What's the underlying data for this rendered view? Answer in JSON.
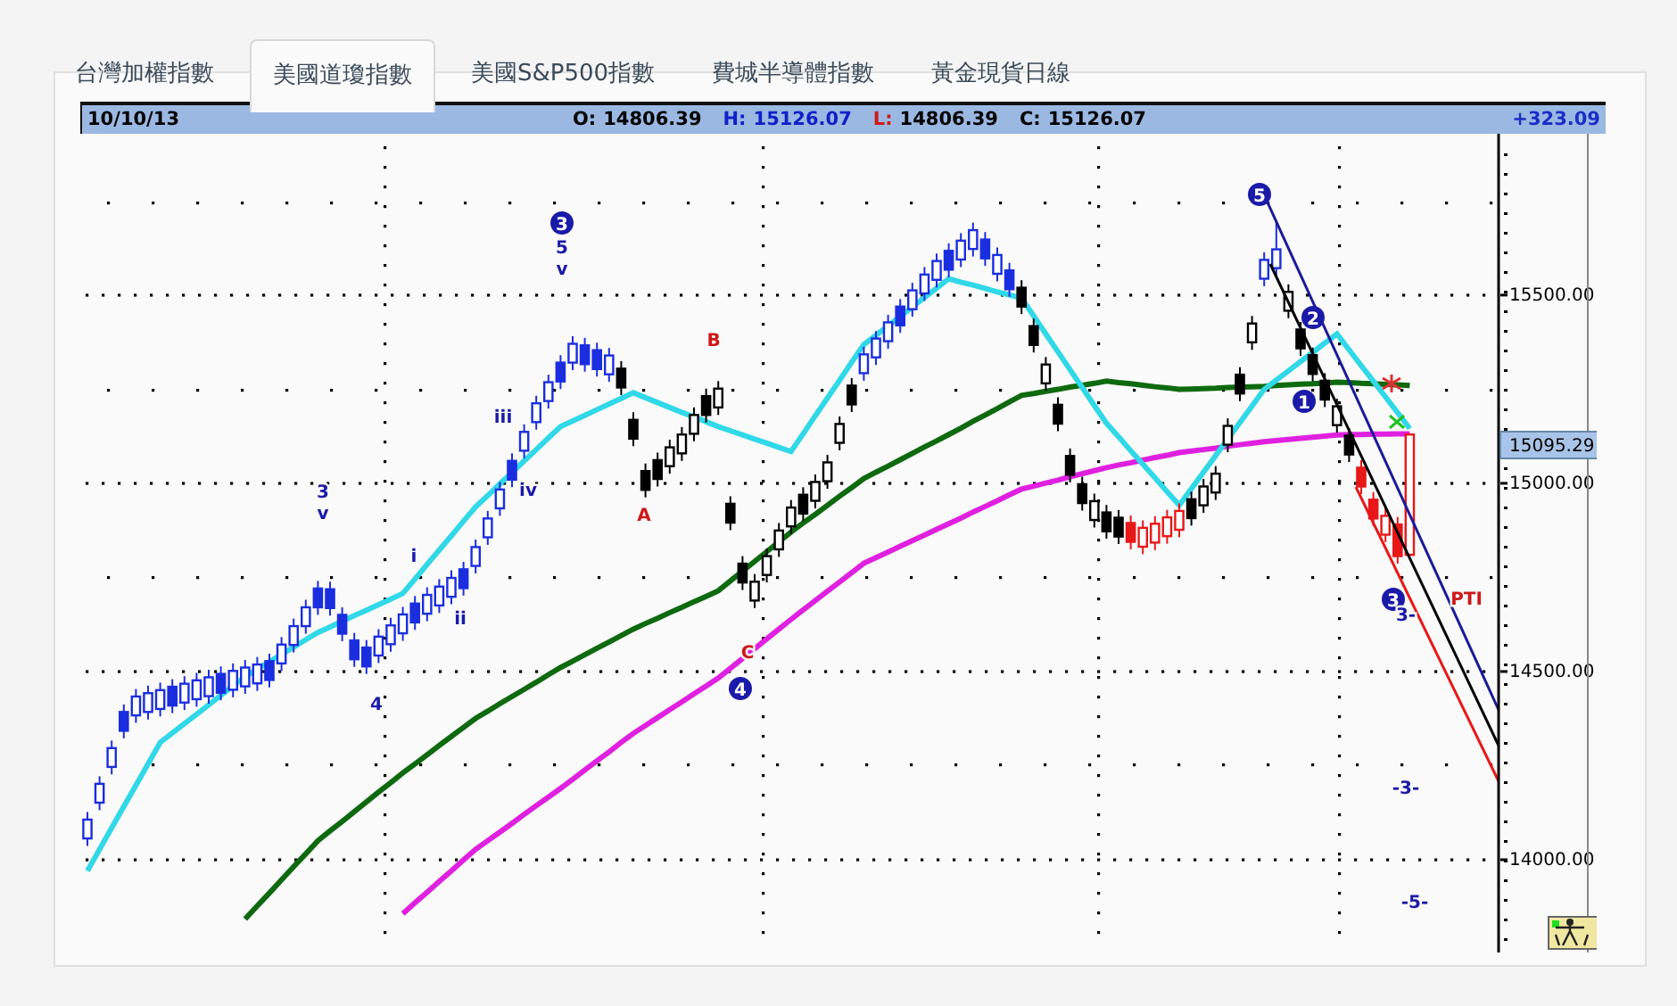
{
  "tabs": [
    {
      "label": "台灣加權指數",
      "selected": false
    },
    {
      "label": "美國道瓊指數",
      "selected": true
    },
    {
      "label": "美國S&P500指數",
      "selected": false
    },
    {
      "label": "費城半導體指數",
      "selected": false
    },
    {
      "label": "黃金現貨日線",
      "selected": false
    }
  ],
  "quote_bar": {
    "date": "10/10/13",
    "fields": [
      {
        "text": "O:",
        "color": "#000000"
      },
      {
        "text": "14806.39",
        "color": "#000000"
      },
      {
        "text": "H:",
        "color": "#1020c8"
      },
      {
        "text": "15126.07",
        "color": "#1020c8"
      },
      {
        "text": "L:",
        "color": "#d01818"
      },
      {
        "text": "14806.39",
        "color": "#000000"
      },
      {
        "text": "C:",
        "color": "#000000"
      },
      {
        "text": "15126.07",
        "color": "#000000"
      }
    ],
    "change": "+323.09"
  },
  "chart_data": {
    "type": "candlestick",
    "ylim": [
      13750,
      15925
    ],
    "yticks": [
      {
        "value": 15500,
        "label": "15500.00"
      },
      {
        "value": 15000,
        "label": "15000.00"
      },
      {
        "value": 14500,
        "label": "14500.00"
      },
      {
        "value": 14000,
        "label": "14000.00"
      }
    ],
    "ohlc": [
      [
        14053,
        14123,
        14033,
        14103
      ],
      [
        14148,
        14218,
        14128,
        14198
      ],
      [
        14243,
        14313,
        14223,
        14293
      ],
      [
        14389,
        14409,
        14319,
        14339
      ],
      [
        14380,
        14450,
        14360,
        14430
      ],
      [
        14389,
        14459,
        14369,
        14439
      ],
      [
        14397,
        14467,
        14377,
        14447
      ],
      [
        14456,
        14476,
        14386,
        14406
      ],
      [
        14414,
        14484,
        14394,
        14464
      ],
      [
        14423,
        14493,
        14403,
        14473
      ],
      [
        14431,
        14501,
        14411,
        14481
      ],
      [
        14490,
        14510,
        14420,
        14440
      ],
      [
        14448,
        14518,
        14428,
        14498
      ],
      [
        14457,
        14527,
        14437,
        14507
      ],
      [
        14465,
        14535,
        14445,
        14515
      ],
      [
        14524,
        14544,
        14454,
        14474
      ],
      [
        14518,
        14588,
        14498,
        14568
      ],
      [
        14567,
        14637,
        14547,
        14617
      ],
      [
        14617,
        14687,
        14597,
        14667
      ],
      [
        14717,
        14737,
        14647,
        14667
      ],
      [
        14715,
        14735,
        14645,
        14665
      ],
      [
        14647,
        14667,
        14577,
        14597
      ],
      [
        14579,
        14599,
        14509,
        14529
      ],
      [
        14560,
        14580,
        14490,
        14510
      ],
      [
        14539,
        14609,
        14519,
        14589
      ],
      [
        14569,
        14639,
        14549,
        14619
      ],
      [
        14598,
        14668,
        14578,
        14648
      ],
      [
        14677,
        14697,
        14607,
        14627
      ],
      [
        14650,
        14720,
        14630,
        14700
      ],
      [
        14672,
        14742,
        14652,
        14722
      ],
      [
        14695,
        14765,
        14675,
        14745
      ],
      [
        14768,
        14788,
        14698,
        14718
      ],
      [
        14777,
        14847,
        14757,
        14827
      ],
      [
        14853,
        14923,
        14833,
        14903
      ],
      [
        14930,
        15000,
        14910,
        14980
      ],
      [
        15056,
        15076,
        14986,
        15006
      ],
      [
        15083,
        15153,
        15063,
        15133
      ],
      [
        15159,
        15229,
        15139,
        15209
      ],
      [
        15215,
        15285,
        15195,
        15265
      ],
      [
        15317,
        15337,
        15247,
        15267
      ],
      [
        15317,
        15387,
        15297,
        15367
      ],
      [
        15363,
        15383,
        15293,
        15313
      ],
      [
        15350,
        15370,
        15280,
        15300
      ],
      [
        15286,
        15356,
        15266,
        15336
      ],
      [
        15301,
        15321,
        15231,
        15251
      ],
      [
        15165,
        15185,
        15095,
        15115
      ],
      [
        15029,
        15049,
        14959,
        14979
      ],
      [
        15058,
        15078,
        14988,
        15008
      ],
      [
        15042,
        15112,
        15022,
        15092
      ],
      [
        15076,
        15146,
        15056,
        15126
      ],
      [
        15128,
        15198,
        15108,
        15178
      ],
      [
        15228,
        15248,
        15158,
        15178
      ],
      [
        15198,
        15268,
        15178,
        15248
      ],
      [
        14942,
        14962,
        14872,
        14892
      ],
      [
        14783,
        14803,
        14713,
        14733
      ],
      [
        14685,
        14755,
        14665,
        14735
      ],
      [
        14753,
        14823,
        14733,
        14803
      ],
      [
        14821,
        14891,
        14801,
        14871
      ],
      [
        14882,
        14952,
        14862,
        14932
      ],
      [
        14966,
        14986,
        14896,
        14916
      ],
      [
        14950,
        15020,
        14930,
        15000
      ],
      [
        15002,
        15072,
        14982,
        15052
      ],
      [
        15104,
        15174,
        15084,
        15154
      ],
      [
        15256,
        15276,
        15186,
        15206
      ],
      [
        15289,
        15359,
        15269,
        15339
      ],
      [
        15331,
        15401,
        15311,
        15381
      ],
      [
        15374,
        15444,
        15354,
        15424
      ],
      [
        15466,
        15486,
        15396,
        15416
      ],
      [
        15459,
        15529,
        15439,
        15509
      ],
      [
        15501,
        15571,
        15481,
        15551
      ],
      [
        15537,
        15607,
        15517,
        15587
      ],
      [
        15614,
        15634,
        15544,
        15564
      ],
      [
        15591,
        15661,
        15571,
        15641
      ],
      [
        15619,
        15689,
        15599,
        15669
      ],
      [
        15644,
        15664,
        15574,
        15594
      ],
      [
        15553,
        15623,
        15533,
        15603
      ],
      [
        15562,
        15582,
        15492,
        15512
      ],
      [
        15516,
        15536,
        15446,
        15466
      ],
      [
        15414,
        15434,
        15344,
        15364
      ],
      [
        15262,
        15332,
        15242,
        15312
      ],
      [
        15205,
        15225,
        15135,
        15155
      ],
      [
        15069,
        15089,
        14999,
        15019
      ],
      [
        14994,
        15014,
        14924,
        14944
      ],
      [
        14899,
        14969,
        14879,
        14949
      ],
      [
        14919,
        14939,
        14849,
        14869
      ],
      [
        14905,
        14925,
        14835,
        14855
      ],
      [
        14891,
        14911,
        14821,
        14841
      ],
      [
        14828,
        14898,
        14808,
        14878
      ],
      [
        14839,
        14909,
        14819,
        14889
      ],
      [
        14856,
        14926,
        14836,
        14906
      ],
      [
        14873,
        14943,
        14853,
        14923
      ],
      [
        14954,
        14974,
        14884,
        14904
      ],
      [
        14938,
        15008,
        14918,
        14988
      ],
      [
        14972,
        15042,
        14952,
        15022
      ],
      [
        15099,
        15169,
        15079,
        15149
      ],
      [
        15285,
        15305,
        15215,
        15235
      ],
      [
        15371,
        15441,
        15351,
        15421
      ],
      [
        15540,
        15610,
        15520,
        15590
      ],
      [
        15568,
        15690,
        15548,
        15618
      ],
      [
        15455,
        15525,
        15435,
        15505
      ],
      [
        15405,
        15425,
        15335,
        15355
      ],
      [
        15337,
        15357,
        15267,
        15287
      ],
      [
        15269,
        15289,
        15199,
        15219
      ],
      [
        15151,
        15221,
        15131,
        15201
      ],
      [
        15123,
        15143,
        15053,
        15073
      ],
      [
        15038,
        15058,
        14968,
        14988
      ],
      [
        14953,
        14973,
        14883,
        14903
      ],
      [
        14860,
        14930,
        14840,
        14910
      ],
      [
        14887,
        14907,
        14783,
        14803
      ],
      [
        14806.39,
        15126.07,
        14806.39,
        15126.07
      ]
    ],
    "colors": [
      "#1a2ee0",
      "#1a2ee0",
      "#1a2ee0",
      "#1a2ee0",
      "#1a2ee0",
      "#1a2ee0",
      "#1a2ee0",
      "#1a2ee0",
      "#1a2ee0",
      "#1a2ee0",
      "#1a2ee0",
      "#1a2ee0",
      "#1a2ee0",
      "#1a2ee0",
      "#1a2ee0",
      "#1a2ee0",
      "#1a2ee0",
      "#1a2ee0",
      "#1a2ee0",
      "#1a2ee0",
      "#1a2ee0",
      "#1a2ee0",
      "#1a2ee0",
      "#1a2ee0",
      "#1a2ee0",
      "#1a2ee0",
      "#1a2ee0",
      "#1a2ee0",
      "#1a2ee0",
      "#1a2ee0",
      "#1a2ee0",
      "#1a2ee0",
      "#1a2ee0",
      "#1a2ee0",
      "#1a2ee0",
      "#1a2ee0",
      "#1a2ee0",
      "#1a2ee0",
      "#1a2ee0",
      "#1a2ee0",
      "#1a2ee0",
      "#1a2ee0",
      "#1a2ee0",
      "#1a2ee0",
      "#000000",
      "#000000",
      "#000000",
      "#000000",
      "#000000",
      "#000000",
      "#000000",
      "#000000",
      "#000000",
      "#000000",
      "#000000",
      "#000000",
      "#000000",
      "#000000",
      "#000000",
      "#000000",
      "#000000",
      "#000000",
      "#000000",
      "#000000",
      "#1a2ee0",
      "#1a2ee0",
      "#1a2ee0",
      "#1a2ee0",
      "#1a2ee0",
      "#1a2ee0",
      "#1a2ee0",
      "#1a2ee0",
      "#1a2ee0",
      "#1a2ee0",
      "#1a2ee0",
      "#1a2ee0",
      "#1a2ee0",
      "#000000",
      "#000000",
      "#000000",
      "#000000",
      "#000000",
      "#000000",
      "#000000",
      "#000000",
      "#000000",
      "#e81818",
      "#e81818",
      "#e81818",
      "#e81818",
      "#e81818",
      "#000000",
      "#000000",
      "#000000",
      "#000000",
      "#000000",
      "#000000",
      "#1a2ee0",
      "#1a2ee0",
      "#000000",
      "#000000",
      "#000000",
      "#000000",
      "#000000",
      "#000000",
      "#e81818",
      "#e81818",
      "#e81818",
      "#e81818",
      "#e81818"
    ],
    "series": [
      {
        "type": "line",
        "color": "#0e6a0e",
        "values": [
          null,
          null,
          null,
          null,
          null,
          null,
          null,
          null,
          null,
          null,
          null,
          null,
          null,
          13839,
          13874,
          13908,
          13943,
          13978,
          14012,
          14047,
          14073,
          14098,
          14124,
          14150,
          14176,
          14201,
          14227,
          14251,
          14275,
          14300,
          14324,
          14348,
          14372,
          14391,
          14411,
          14430,
          14449,
          14468,
          14488,
          14507,
          14524,
          14541,
          14558,
          14575,
          14592,
          14609,
          14624,
          14638,
          14653,
          14667,
          14682,
          14696,
          14711,
          14737,
          14763,
          14789,
          14815,
          14841,
          14867,
          14891,
          14914,
          14938,
          14962,
          14985,
          15009,
          15026,
          15042,
          15059,
          15076,
          15093,
          15109,
          15126,
          15143,
          15161,
          15178,
          15195,
          15213,
          15230,
          15235,
          15241,
          15246,
          15252,
          15257,
          15262,
          15268,
          15264,
          15261,
          15257,
          15253,
          15250,
          15246,
          15247,
          15248,
          15249,
          15251,
          15252,
          15253,
          15254,
          15256,
          15258,
          15260,
          15261,
          15263,
          15265,
          15264,
          15262,
          15261,
          15259,
          15258,
          15256
        ]
      },
      {
        "type": "line",
        "color": "#e020e0",
        "values": [
          null,
          null,
          null,
          null,
          null,
          null,
          null,
          null,
          null,
          null,
          null,
          null,
          null,
          null,
          null,
          null,
          null,
          null,
          null,
          null,
          null,
          null,
          null,
          null,
          null,
          null,
          13853,
          13882,
          13910,
          13939,
          13967,
          13996,
          14024,
          14047,
          14070,
          14093,
          14117,
          14140,
          14163,
          14186,
          14210,
          14235,
          14259,
          14283,
          14308,
          14332,
          14353,
          14374,
          14395,
          14416,
          14437,
          14458,
          14479,
          14505,
          14531,
          14557,
          14583,
          14609,
          14635,
          14660,
          14685,
          14710,
          14734,
          14759,
          14784,
          14799,
          14814,
          14829,
          14844,
          14859,
          14874,
          14889,
          14904,
          14920,
          14935,
          14950,
          14966,
          14981,
          14989,
          14997,
          15005,
          15014,
          15022,
          15030,
          15038,
          15045,
          15051,
          15058,
          15065,
          15071,
          15078,
          15082,
          15086,
          15090,
          15095,
          15099,
          15103,
          15107,
          15110,
          15113,
          15116,
          15119,
          15122,
          15125,
          15126,
          15126,
          15127,
          15127,
          15128,
          15128
        ]
      },
      {
        "type": "line",
        "color": "#30d8e8",
        "values": [
          13967,
          14024,
          14081,
          14138,
          14194,
          14251,
          14308,
          14333,
          14358,
          14383,
          14408,
          14433,
          14458,
          14483,
          14503,
          14522,
          14542,
          14561,
          14581,
          14600,
          14615,
          14630,
          14645,
          14659,
          14674,
          14689,
          14704,
          14742,
          14781,
          14819,
          14857,
          14896,
          14934,
          14964,
          14995,
          15025,
          15056,
          15086,
          15117,
          15147,
          15162,
          15177,
          15192,
          15207,
          15222,
          15237,
          15224,
          15211,
          15198,
          15185,
          15173,
          15160,
          15147,
          15136,
          15125,
          15114,
          15103,
          15092,
          15081,
          15128,
          15176,
          15223,
          15270,
          15318,
          15365,
          15390,
          15415,
          15440,
          15465,
          15490,
          15515,
          15540,
          15531,
          15523,
          15514,
          15505,
          15497,
          15488,
          15441,
          15393,
          15346,
          15298,
          15251,
          15203,
          15156,
          15120,
          15083,
          15047,
          15011,
          14974,
          14938,
          14982,
          15026,
          15070,
          15114,
          15158,
          15202,
          15246,
          15271,
          15295,
          15320,
          15344,
          15369,
          15393,
          15351,
          15309,
          15268,
          15226,
          15184,
          15142
        ]
      }
    ]
  },
  "current_price": "15095.29",
  "annotations": [
    {
      "kind": "circle",
      "text": "3",
      "color": "#1a1aa8"
    },
    {
      "kind": "label",
      "text": "5",
      "color": "#1a1aa8"
    },
    {
      "kind": "label",
      "text": "v",
      "color": "#1a1aa8"
    },
    {
      "kind": "label",
      "text": "3",
      "color": "#1a1aa8"
    },
    {
      "kind": "label",
      "text": "v",
      "color": "#1a1aa8"
    },
    {
      "kind": "label",
      "text": "i",
      "color": "#1a1aa8"
    },
    {
      "kind": "label",
      "text": "ii",
      "color": "#1a1aa8"
    },
    {
      "kind": "label",
      "text": "iii",
      "color": "#1a1aa8"
    },
    {
      "kind": "label",
      "text": "iv",
      "color": "#1a1aa8"
    },
    {
      "kind": "label",
      "text": "4",
      "color": "#1a1aa8"
    },
    {
      "kind": "label",
      "text": "A",
      "color": "#d01818"
    },
    {
      "kind": "label",
      "text": "B",
      "color": "#d01818"
    },
    {
      "kind": "label",
      "text": "C",
      "color": "#d01818"
    },
    {
      "kind": "circle",
      "text": "4",
      "color": "#1a1aa8"
    },
    {
      "kind": "circle",
      "text": "5",
      "color": "#1a1aa8"
    },
    {
      "kind": "circle",
      "text": "2",
      "color": "#1a1aa8"
    },
    {
      "kind": "circle",
      "text": "1",
      "color": "#1a1aa8"
    },
    {
      "kind": "circle",
      "text": "3",
      "color": "#1a1aa8"
    },
    {
      "kind": "label",
      "text": "3-",
      "color": "#1a1aa8"
    },
    {
      "kind": "label",
      "text": "PTI",
      "color": "#d01818"
    },
    {
      "kind": "label",
      "text": "-3-",
      "color": "#1a1aa8"
    },
    {
      "kind": "label",
      "text": "-5-",
      "color": "#1a1aa8"
    }
  ]
}
